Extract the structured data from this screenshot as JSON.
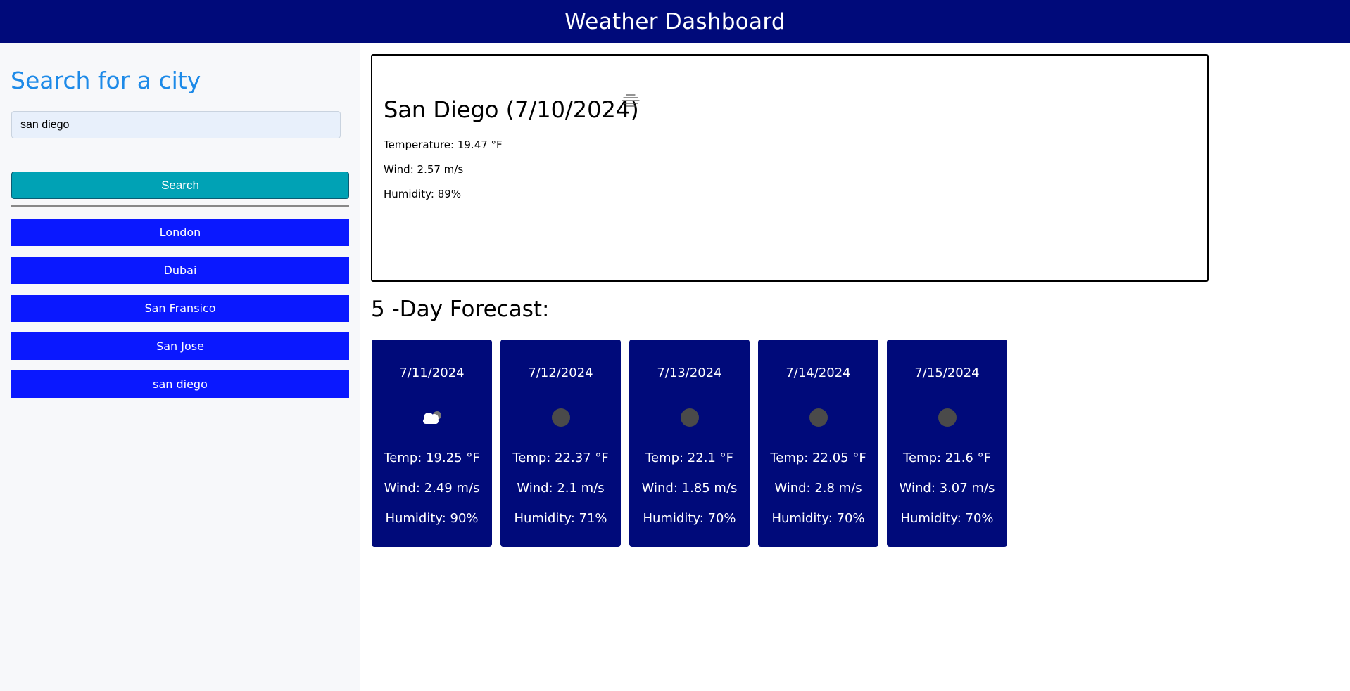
{
  "header": {
    "title": "Weather Dashboard"
  },
  "sidebar": {
    "title": "Search for a city",
    "search": {
      "value": "san diego",
      "placeholder": ""
    },
    "search_button_label": "Search",
    "history": [
      "London",
      "Dubai",
      "San Fransico",
      "San Jose",
      "san diego"
    ]
  },
  "current": {
    "title": "San Diego (7/10/2024)",
    "icon": "mist-icon",
    "temperature": "Temperature: 19.47 °F",
    "wind": "Wind: 2.57 m/s",
    "humidity": "Humidity: 89%"
  },
  "forecast": {
    "heading": "5 -Day Forecast:",
    "days": [
      {
        "date": "7/11/2024",
        "icon": "cloud-icon",
        "temp": "Temp: 19.25 °F",
        "wind": "Wind: 2.49 m/s",
        "humidity": "Humidity: 90%"
      },
      {
        "date": "7/12/2024",
        "icon": "clear-night-icon",
        "temp": "Temp: 22.37 °F",
        "wind": "Wind: 2.1 m/s",
        "humidity": "Humidity: 71%"
      },
      {
        "date": "7/13/2024",
        "icon": "clear-night-icon",
        "temp": "Temp: 22.1 °F",
        "wind": "Wind: 1.85 m/s",
        "humidity": "Humidity: 70%"
      },
      {
        "date": "7/14/2024",
        "icon": "clear-night-icon",
        "temp": "Temp: 22.05 °F",
        "wind": "Wind: 2.8 m/s",
        "humidity": "Humidity: 70%"
      },
      {
        "date": "7/15/2024",
        "icon": "clear-night-icon",
        "temp": "Temp: 21.6 °F",
        "wind": "Wind: 3.07 m/s",
        "humidity": "Humidity: 70%"
      }
    ]
  },
  "colors": {
    "header_bg": "#000a7a",
    "accent_title": "#1d8ae8",
    "search_button": "#00a2b5",
    "history_button": "#0a18ff",
    "forecast_card": "#000a7a"
  }
}
